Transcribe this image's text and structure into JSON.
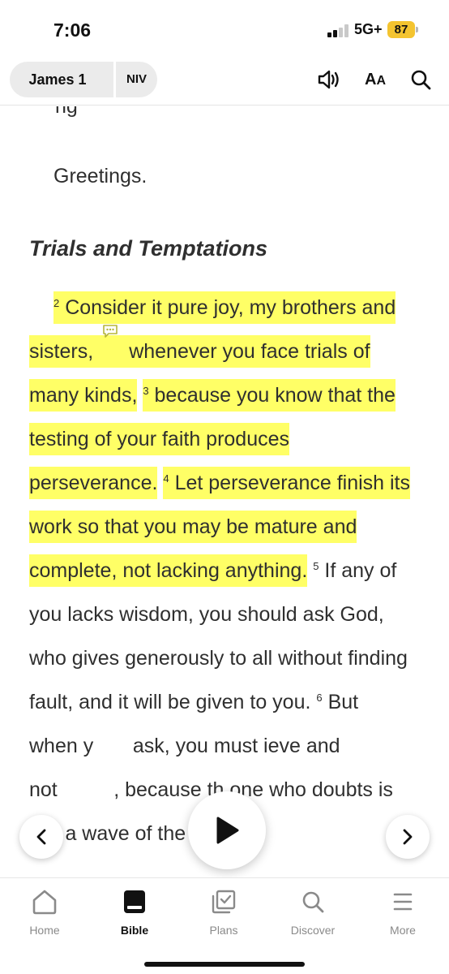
{
  "status_bar": {
    "time": "7:06",
    "network": "5G+",
    "battery": "87"
  },
  "header": {
    "book_chapter": "James 1",
    "version": "NIV",
    "audio_icon": "speaker-icon",
    "font_size_label_big": "A",
    "font_size_label_small": "A",
    "search_icon": "search-icon"
  },
  "content": {
    "greeting": "Greetings.",
    "section_heading": "Trials and Temptations",
    "verse2_num": "2",
    "verse2_part1": "Consider it pure joy, my brothers and sisters,",
    "verse2_part2": "whenever you face trials of many kinds,",
    "verse3_num": "3",
    "verse3_text": "because you know that the testing of your faith produces perseverance.",
    "verse4_num": "4",
    "verse4_text": "Let perseverance finish its work so that you may be mature and complete, not lacking anything.",
    "verse5_num": "5",
    "verse5_text": "If any of you lacks wisdom, you should ask God, who gives generously to all without finding fault, and it will be given to you.",
    "verse6_num": "6",
    "verse6_a": "But when y",
    "verse6_b": "ask, you must",
    "verse6_c": "ieve and not",
    "verse6_d": ", because th",
    "verse6_e": "one who doubts is like a wave of the"
  },
  "colors": {
    "highlight": "#ffff66",
    "text": "#2f2f2f",
    "accent": "#f4c430"
  },
  "tabs": [
    {
      "label": "Home",
      "icon": "home-icon",
      "active": false
    },
    {
      "label": "Bible",
      "icon": "bible-icon",
      "active": true
    },
    {
      "label": "Plans",
      "icon": "plans-icon",
      "active": false
    },
    {
      "label": "Discover",
      "icon": "discover-icon",
      "active": false
    },
    {
      "label": "More",
      "icon": "menu-icon",
      "active": false
    }
  ]
}
